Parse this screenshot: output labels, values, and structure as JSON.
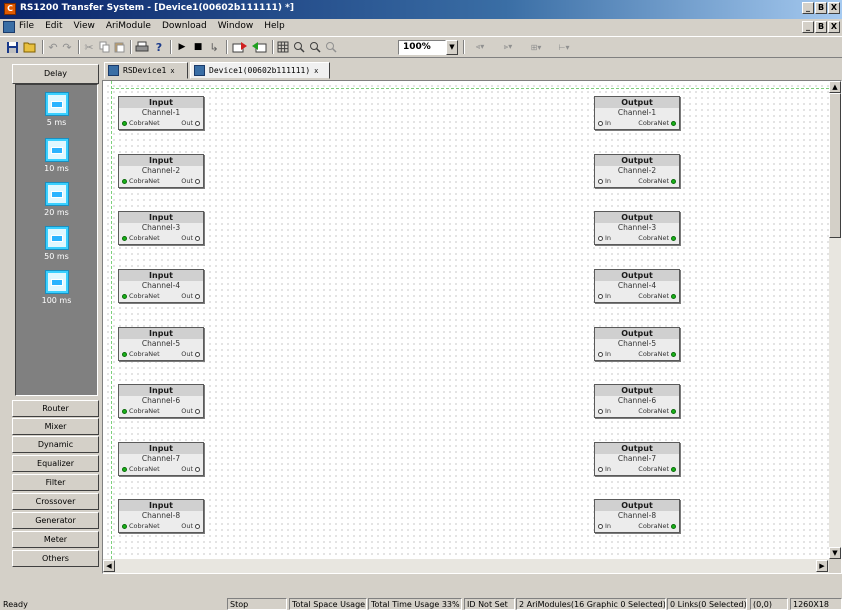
{
  "window": {
    "title": "RS1200 Transfer System - [Device1(00602b111111) *]",
    "controls": [
      "_",
      "B",
      "X"
    ]
  },
  "menubar": {
    "items": [
      "File",
      "Edit",
      "View",
      "AriModule",
      "Download",
      "Window",
      "Help"
    ],
    "controls": [
      "_",
      "B",
      "X"
    ]
  },
  "toolbar": {
    "zoom_value": "100%"
  },
  "left_panel": {
    "active_category": "Delay",
    "delay_items": [
      "5 ms",
      "10 ms",
      "20 ms",
      "50 ms",
      "100 ms"
    ],
    "categories": [
      "Router",
      "Mixer",
      "Dynamic",
      "Equalizer",
      "Filter",
      "Crossover",
      "Generator",
      "Meter",
      "Others"
    ]
  },
  "tabs": [
    {
      "label": "RSDevice1",
      "close": "x"
    },
    {
      "label": "Device1(00602b111111)",
      "close": "x"
    }
  ],
  "canvas": {
    "input_modules": [
      {
        "title": "Input",
        "channel": "Channel-1",
        "left_port": "CobraNet",
        "right_port": "Out"
      },
      {
        "title": "Input",
        "channel": "Channel-2",
        "left_port": "CobraNet",
        "right_port": "Out"
      },
      {
        "title": "Input",
        "channel": "Channel-3",
        "left_port": "CobraNet",
        "right_port": "Out"
      },
      {
        "title": "Input",
        "channel": "Channel-4",
        "left_port": "CobraNet",
        "right_port": "Out"
      },
      {
        "title": "Input",
        "channel": "Channel-5",
        "left_port": "CobraNet",
        "right_port": "Out"
      },
      {
        "title": "Input",
        "channel": "Channel-6",
        "left_port": "CobraNet",
        "right_port": "Out"
      },
      {
        "title": "Input",
        "channel": "Channel-7",
        "left_port": "CobraNet",
        "right_port": "Out"
      },
      {
        "title": "Input",
        "channel": "Channel-8",
        "left_port": "CobraNet",
        "right_port": "Out"
      }
    ],
    "output_modules": [
      {
        "title": "Output",
        "channel": "Channel-1",
        "left_port": "In",
        "right_port": "CobraNet"
      },
      {
        "title": "Output",
        "channel": "Channel-2",
        "left_port": "In",
        "right_port": "CobraNet"
      },
      {
        "title": "Output",
        "channel": "Channel-3",
        "left_port": "In",
        "right_port": "CobraNet"
      },
      {
        "title": "Output",
        "channel": "Channel-4",
        "left_port": "In",
        "right_port": "CobraNet"
      },
      {
        "title": "Output",
        "channel": "Channel-5",
        "left_port": "In",
        "right_port": "CobraNet"
      },
      {
        "title": "Output",
        "channel": "Channel-6",
        "left_port": "In",
        "right_port": "CobraNet"
      },
      {
        "title": "Output",
        "channel": "Channel-7",
        "left_port": "In",
        "right_port": "CobraNet"
      },
      {
        "title": "Output",
        "channel": "Channel-8",
        "left_port": "In",
        "right_port": "CobraNet"
      }
    ]
  },
  "statusbar": {
    "ready": "Ready",
    "stop": "Stop",
    "space_usage": "Total Space Usage",
    "time_usage": "Total Time Usage 33%",
    "id_status": "ID Not Set",
    "modules": "2 AriModules(16 Graphic 0 Selected)",
    "links": "0 Links(0 Selected)",
    "coords": "(0,0)",
    "resolution": "1260X18"
  },
  "colors": {
    "titlebar_start": "#0a246a",
    "port_connected": "#19b319",
    "delay_panel": "#808080",
    "guide": "#7bd07b"
  }
}
